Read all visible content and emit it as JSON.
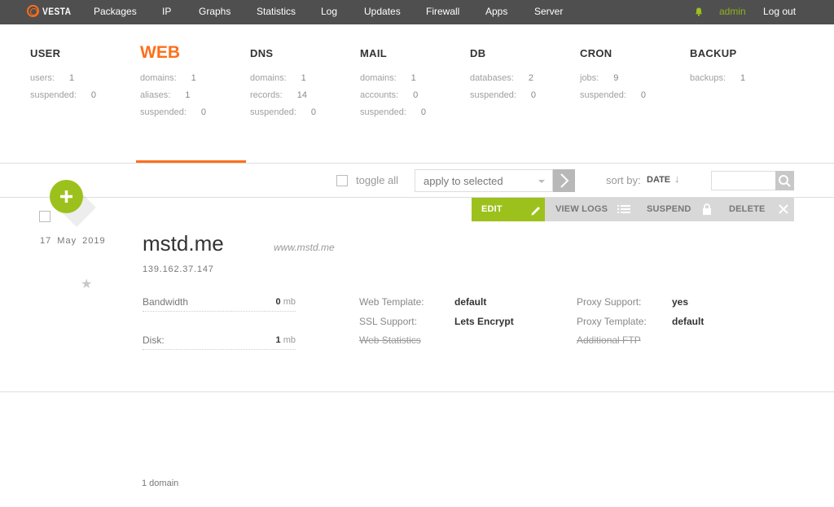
{
  "brand": {
    "name": "VESTA",
    "accent": "#ff6e1a",
    "green": "#9dc11c"
  },
  "nav": {
    "items": [
      "Packages",
      "IP",
      "Graphs",
      "Statistics",
      "Log",
      "Updates",
      "Firewall",
      "Apps",
      "Server"
    ],
    "user": "admin",
    "logout": "Log out"
  },
  "stats": {
    "user": {
      "title": "USER",
      "rows": [
        {
          "label": "users:",
          "value": "1"
        },
        {
          "label": "suspended:",
          "value": "0"
        }
      ]
    },
    "web": {
      "title": "WEB",
      "rows": [
        {
          "label": "domains:",
          "value": "1"
        },
        {
          "label": "aliases:",
          "value": "1"
        },
        {
          "label": "suspended:",
          "value": "0"
        }
      ]
    },
    "dns": {
      "title": "DNS",
      "rows": [
        {
          "label": "domains:",
          "value": "1"
        },
        {
          "label": "records:",
          "value": "14"
        },
        {
          "label": "suspended:",
          "value": "0"
        }
      ]
    },
    "mail": {
      "title": "MAIL",
      "rows": [
        {
          "label": "domains:",
          "value": "1"
        },
        {
          "label": "accounts:",
          "value": "0"
        },
        {
          "label": "suspended:",
          "value": "0"
        }
      ]
    },
    "db": {
      "title": "DB",
      "rows": [
        {
          "label": "databases:",
          "value": "2"
        },
        {
          "label": "suspended:",
          "value": "0"
        }
      ]
    },
    "cron": {
      "title": "CRON",
      "rows": [
        {
          "label": "jobs:",
          "value": "9"
        },
        {
          "label": "suspended:",
          "value": "0"
        }
      ]
    },
    "backup": {
      "title": "BACKUP",
      "rows": [
        {
          "label": "backups:",
          "value": "1"
        }
      ]
    }
  },
  "toolbar": {
    "toggle_all": "toggle all",
    "apply_placeholder": "apply to selected",
    "sort_label": "sort by:",
    "sort_value": "DATE",
    "sort_arrow": "↓"
  },
  "actions": {
    "edit": "EDIT",
    "view_logs": "VIEW LOGS",
    "suspend": "SUSPEND",
    "delete": "DELETE"
  },
  "domain": {
    "date": "17  May  2019",
    "name": "mstd.me",
    "alias": "www.mstd.me",
    "ip": "139.162.37.147",
    "bandwidth": {
      "label": "Bandwidth",
      "value": "0",
      "unit": "mb"
    },
    "disk": {
      "label": "Disk:",
      "value": "1",
      "unit": "mb"
    },
    "web_template": {
      "label": "Web Template:",
      "value": "default"
    },
    "ssl_support": {
      "label": "SSL Support:",
      "value": "Lets Encrypt"
    },
    "web_statistics": {
      "label": "Web Statistics"
    },
    "proxy_support": {
      "label": "Proxy Support:",
      "value": "yes"
    },
    "proxy_template": {
      "label": "Proxy Template:",
      "value": "default"
    },
    "additional_ftp": {
      "label": "Additional FTP"
    }
  },
  "footer": {
    "count": "1 domain"
  }
}
